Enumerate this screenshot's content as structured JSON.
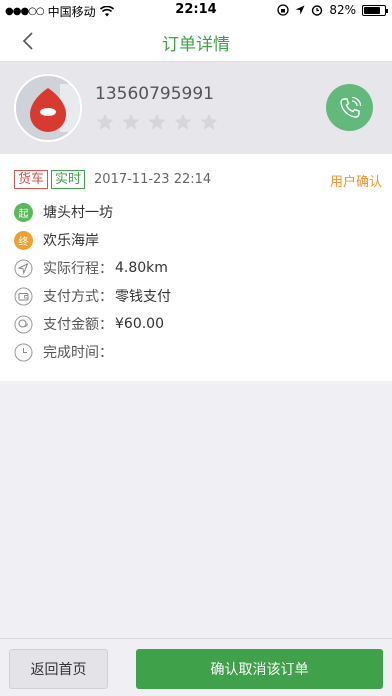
{
  "status_bar": {
    "signal": "●●●○○",
    "carrier": "中国移动",
    "time": "22:14",
    "battery": "82%",
    "battery_level": 0.82
  },
  "nav": {
    "title": "订单详情"
  },
  "driver": {
    "phone": "13560795991",
    "rating": 0,
    "max_rating": 5
  },
  "order": {
    "tags": [
      "货车",
      "实时"
    ],
    "datetime": "2017-11-23 22:14",
    "status": "用户确认",
    "start_badge": "起",
    "start": "塘头村一坊",
    "end_badge": "终",
    "end": "欢乐海岸",
    "distance_label": "实际行程：",
    "distance_value": "4.80km",
    "pay_method_label": "支付方式：",
    "pay_method_value": "零钱支付",
    "amount_label": "支付金额：",
    "amount_value": "¥60.00",
    "finish_label": "完成时间：",
    "finish_value": ""
  },
  "actions": {
    "home": "返回首页",
    "confirm": "确认取消该订单"
  },
  "colors": {
    "accent": "#3fa14a",
    "status": "#f0932b",
    "tag_red": "#d9534f"
  }
}
